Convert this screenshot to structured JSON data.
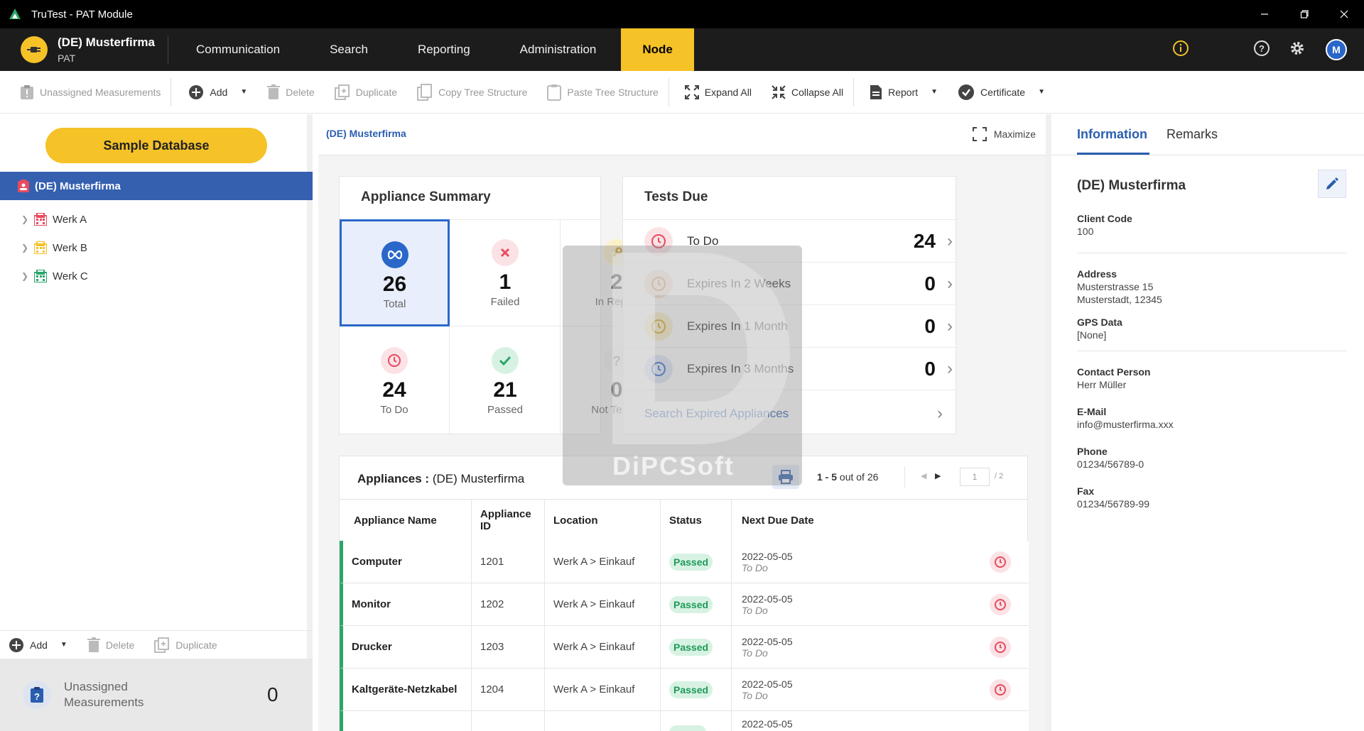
{
  "window": {
    "title": "TruTest - PAT Module"
  },
  "header": {
    "company_name": "(DE) Musterfirma",
    "company_sub": "PAT",
    "nav": [
      "Communication",
      "Search",
      "Reporting",
      "Administration",
      "Node"
    ],
    "active_nav": "Node",
    "avatar_initial": "M"
  },
  "toolbar": {
    "unassigned": "Unassigned Measurements",
    "add": "Add",
    "delete": "Delete",
    "duplicate": "Duplicate",
    "copy_tree": "Copy Tree Structure",
    "paste_tree": "Paste Tree Structure",
    "expand_all": "Expand All",
    "collapse_all": "Collapse All",
    "report": "Report",
    "certificate": "Certificate"
  },
  "left": {
    "db_button": "Sample Database",
    "root": "(DE) Musterfirma",
    "children": [
      "Werk A",
      "Werk B",
      "Werk C"
    ],
    "child_colors": [
      "#e84a5f",
      "#f5c228",
      "#2ba66b"
    ],
    "bottom_add": "Add",
    "bottom_delete": "Delete",
    "bottom_duplicate": "Duplicate",
    "unassigned_line1": "Unassigned",
    "unassigned_line2": "Measurements",
    "unassigned_count": "0"
  },
  "center": {
    "breadcrumb": "(DE) Musterfirma",
    "maximize": "Maximize",
    "summary_title": "Appliance Summary",
    "summary": [
      {
        "value": "26",
        "label": "Total",
        "color": "#2a67c9"
      },
      {
        "value": "1",
        "label": "Failed",
        "color": "#e84a5f"
      },
      {
        "value": "2",
        "label": "In Repair",
        "color": "#f5c228"
      },
      {
        "value": "24",
        "label": "To Do",
        "color": "#e84a5f"
      },
      {
        "value": "21",
        "label": "Passed",
        "color": "#2ba66b"
      },
      {
        "value": "0",
        "label": "Not Tested",
        "color": "#999999"
      }
    ],
    "due_title": "Tests Due",
    "due": [
      {
        "label": "To Do",
        "value": "24",
        "color": "#e84a5f"
      },
      {
        "label": "Expires In 2 Weeks",
        "value": "0",
        "color": "#c87a3a"
      },
      {
        "label": "Expires In 1 Month",
        "value": "0",
        "color": "#f5c228"
      },
      {
        "label": "Expires In 3 Months",
        "value": "0",
        "color": "#2a67c9"
      }
    ],
    "search_expired": "Search Expired Appliances",
    "appliances_label": "Appliances :",
    "appliances_node": "(DE) Musterfirma",
    "paging_range": "1 - 5",
    "paging_of": "out of 26",
    "page_current": "1",
    "page_total": "/ 2",
    "columns": [
      "Appliance Name",
      "Appliance ID",
      "Location",
      "Status",
      "Next Due Date"
    ],
    "rows": [
      {
        "name": "Computer",
        "id": "1201",
        "location": "Werk A > Einkauf",
        "status": "Passed",
        "date": "2022-05-05",
        "due": "To Do"
      },
      {
        "name": "Monitor",
        "id": "1202",
        "location": "Werk A > Einkauf",
        "status": "Passed",
        "date": "2022-05-05",
        "due": "To Do"
      },
      {
        "name": "Drucker",
        "id": "1203",
        "location": "Werk A > Einkauf",
        "status": "Passed",
        "date": "2022-05-05",
        "due": "To Do"
      },
      {
        "name": "Kaltgeräte-Netzkabel",
        "id": "1204",
        "location": "Werk A > Einkauf",
        "status": "Passed",
        "date": "2022-05-05",
        "due": "To Do"
      },
      {
        "name": "",
        "id": "",
        "location": "",
        "status": "",
        "date": "2022-05-05",
        "due": ""
      }
    ],
    "watermark": "DiPCSoft"
  },
  "right": {
    "tab_info": "Information",
    "tab_remarks": "Remarks",
    "name": "(DE) Musterfirma",
    "client_code_label": "Client Code",
    "client_code": "100",
    "address_label": "Address",
    "address_line1": "Musterstrasse 15",
    "address_line2": "Musterstadt, 12345",
    "gps_label": "GPS Data",
    "gps": "[None]",
    "contact_label": "Contact Person",
    "contact": "Herr Müller",
    "email_label": "E-Mail",
    "email": "info@musterfirma.xxx",
    "phone_label": "Phone",
    "phone": "01234/56789-0",
    "fax_label": "Fax",
    "fax": "01234/56789-99"
  }
}
